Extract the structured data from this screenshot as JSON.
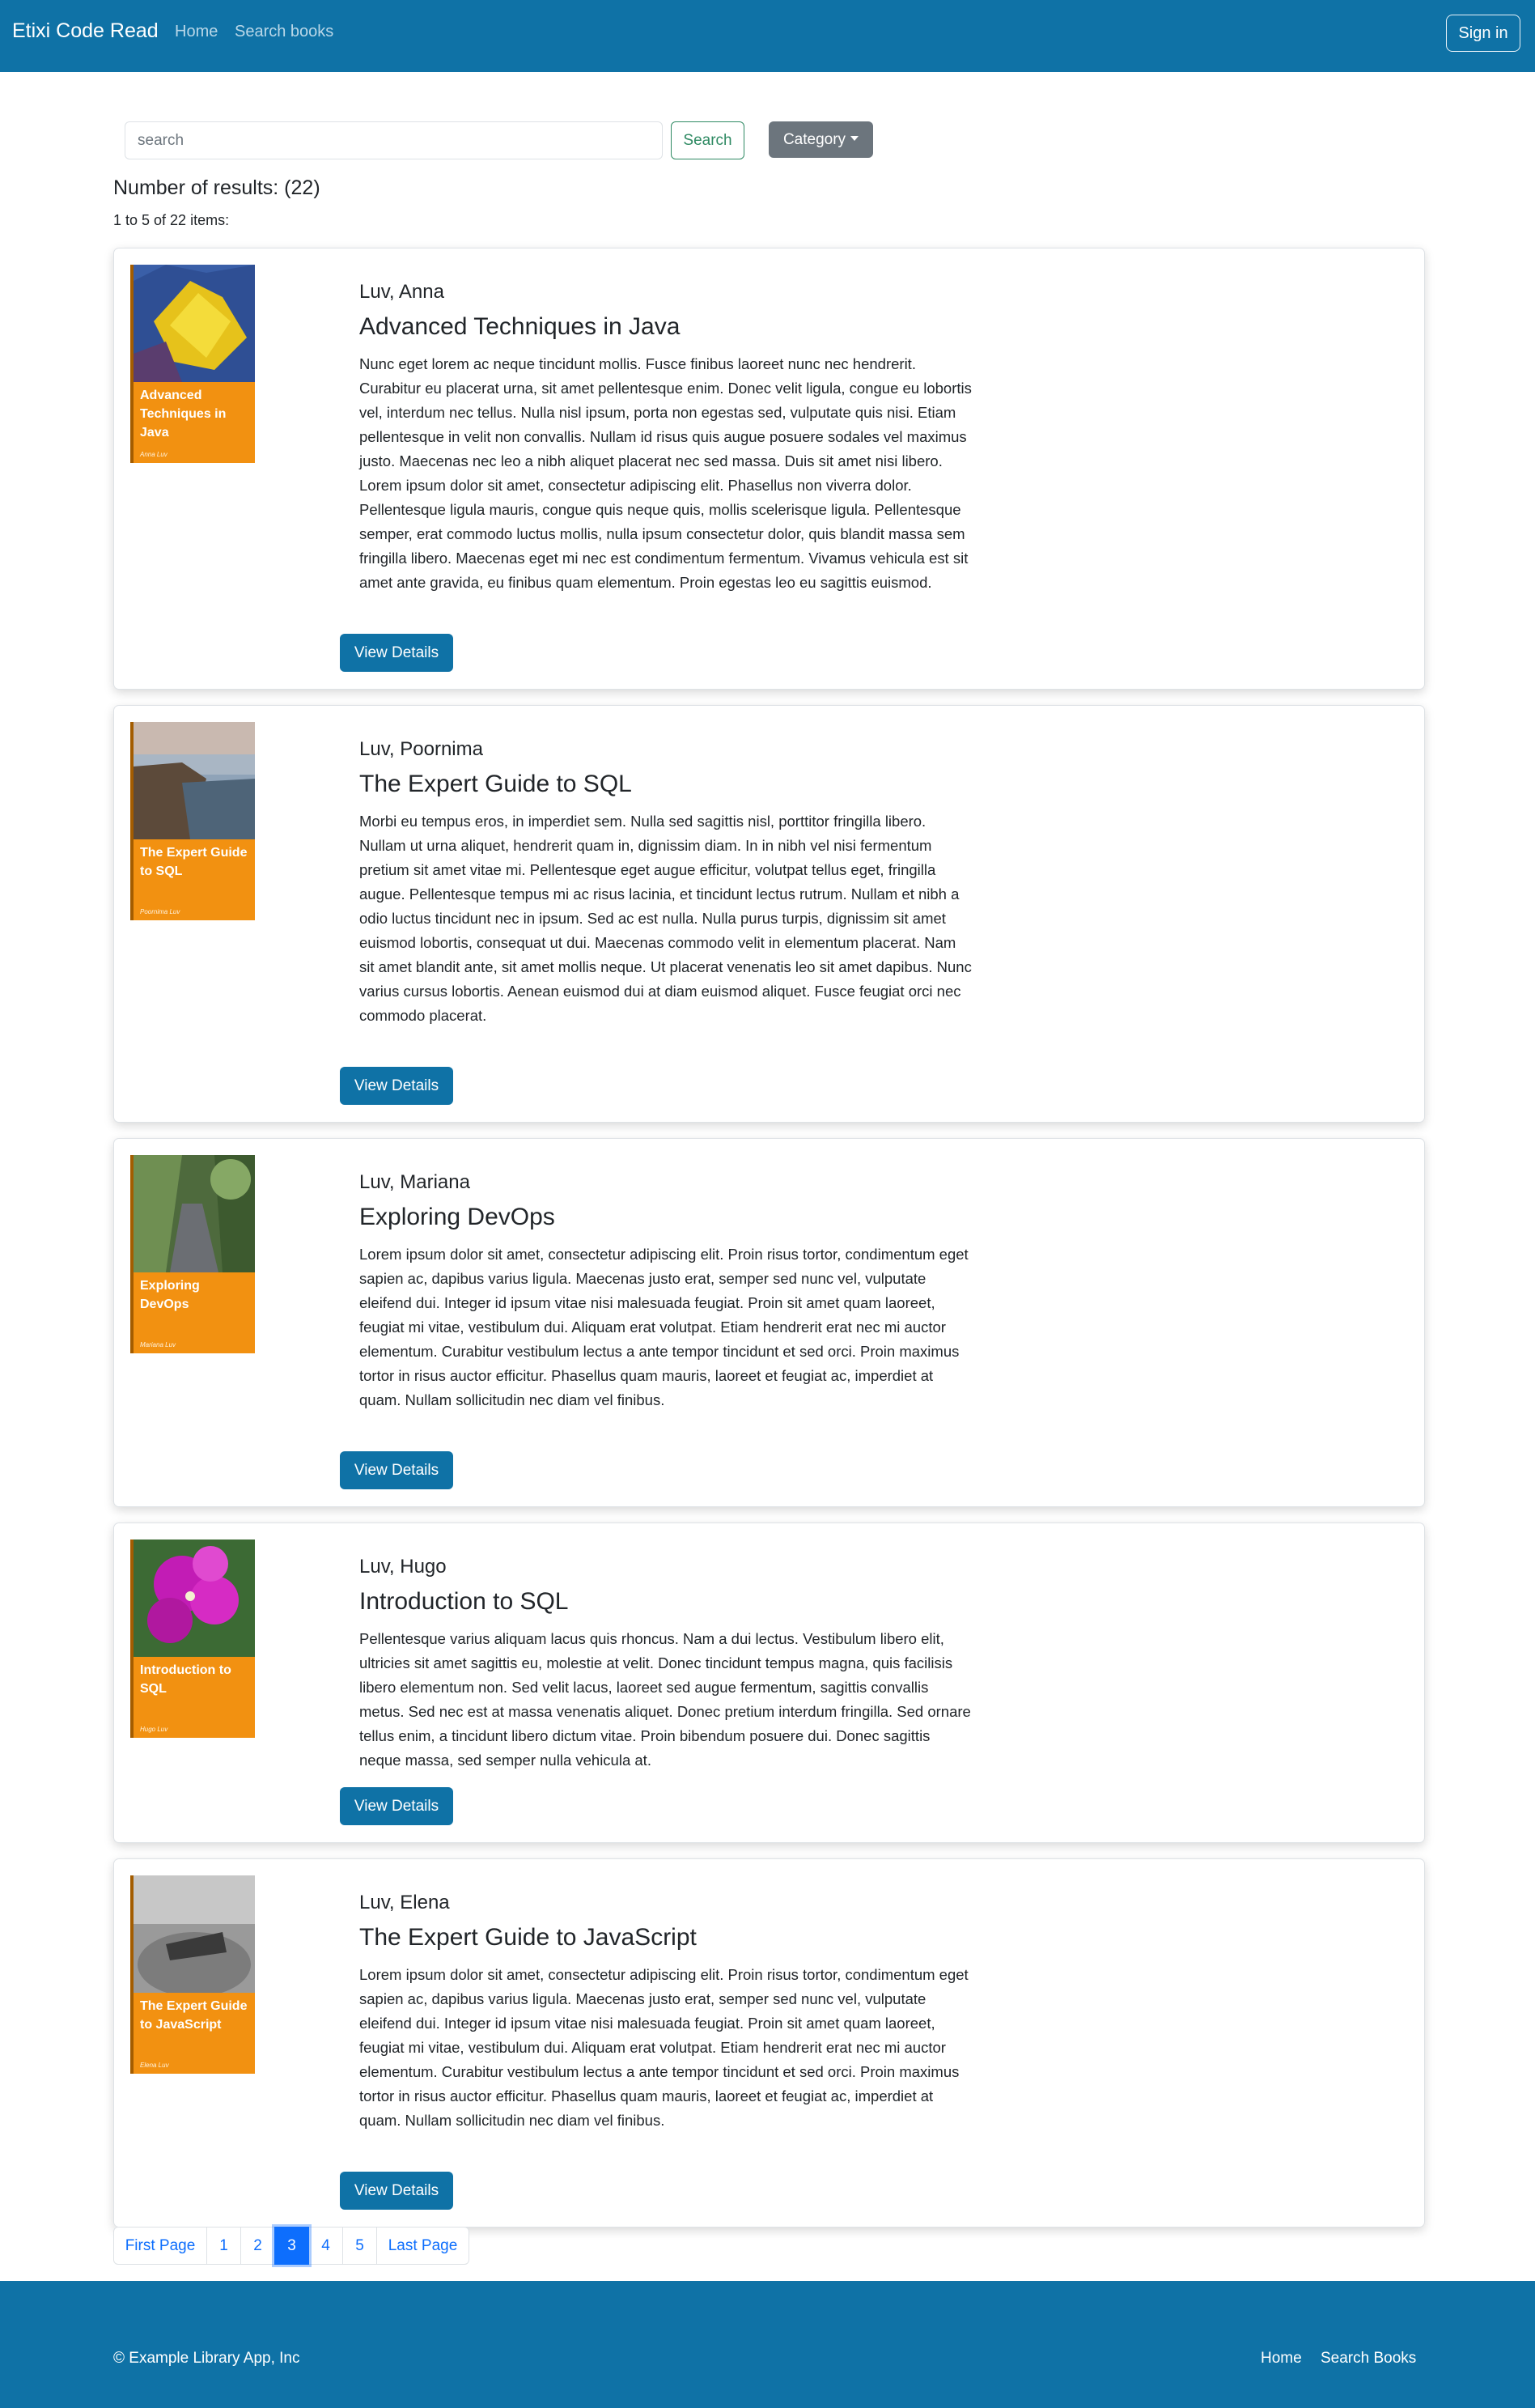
{
  "navbar": {
    "brand": "Etixi Code Read",
    "links": [
      "Home",
      "Search books"
    ],
    "signin_label": "Sign in",
    "color": "#0f72a6"
  },
  "search": {
    "placeholder": "search",
    "button_label": "Search",
    "category_label": "Category"
  },
  "results": {
    "count_text": "Number of results: (22)",
    "range_text": "1 to 5 of 22 items:"
  },
  "books": [
    {
      "author": "Luv, Anna",
      "title": "Advanced Techniques in Java",
      "description": "Nunc eget lorem ac neque tincidunt mollis. Fusce finibus laoreet nunc nec hendrerit. Curabitur eu placerat urna, sit amet pellentesque enim. Donec velit ligula, congue eu lobortis vel, interdum nec tellus. Nulla nisl ipsum, porta non egestas sed, vulputate quis nisi. Etiam pellentesque in velit non convallis. Nullam id risus quis augue posuere sodales vel maximus justo. Maecenas nec leo a nibh aliquet placerat nec sed massa. Duis sit amet nisi libero. Lorem ipsum dolor sit amet, consectetur adipiscing elit. Phasellus non viverra dolor. Pellentesque ligula mauris, congue quis neque quis, mollis scelerisque ligula. Pellentesque semper, erat commodo luctus mollis, nulla ipsum consectetur dolor, quis blandit massa sem fringilla libero. Maecenas eget mi nec est condimentum fermentum. Vivamus vehicula est sit amet ante gravida, eu finibus quam elementum. Proin egestas leo eu sagittis euismod.",
      "cover_title": "Advanced Techniques in Java",
      "cover_author": "Anna Luv",
      "button_label": "View Details"
    },
    {
      "author": "Luv, Poornima",
      "title": "The Expert Guide to SQL",
      "description": "Morbi eu tempus eros, in imperdiet sem. Nulla sed sagittis nisl, porttitor fringilla libero. Nullam ut urna aliquet, hendrerit quam in, dignissim diam. In in nibh vel nisi fermentum pretium sit amet vitae mi. Pellentesque eget augue efficitur, volutpat tellus eget, fringilla augue. Pellentesque tempus mi ac risus lacinia, et tincidunt lectus rutrum. Nullam et nibh a odio luctus tincidunt nec in ipsum. Sed ac est nulla. Nulla purus turpis, dignissim sit amet euismod lobortis, consequat ut dui. Maecenas commodo velit in elementum placerat. Nam sit amet blandit ante, sit amet mollis neque. Ut placerat venenatis leo sit amet dapibus. Nunc varius cursus lobortis. Aenean euismod dui at diam euismod aliquet. Fusce feugiat orci nec commodo placerat.",
      "cover_title": "The Expert Guide to SQL",
      "cover_author": "Poornima Luv",
      "button_label": "View Details"
    },
    {
      "author": "Luv, Mariana",
      "title": "Exploring DevOps",
      "description": "Lorem ipsum dolor sit amet, consectetur adipiscing elit. Proin risus tortor, condimentum eget sapien ac, dapibus varius ligula. Maecenas justo erat, semper sed nunc vel, vulputate eleifend dui. Integer id ipsum vitae nisi malesuada feugiat. Proin sit amet quam laoreet, feugiat mi vitae, vestibulum dui. Aliquam erat volutpat. Etiam hendrerit erat nec mi auctor elementum. Curabitur vestibulum lectus a ante tempor tincidunt et sed orci. Proin maximus tortor in risus auctor efficitur. Phasellus quam mauris, laoreet et feugiat ac, imperdiet at quam. Nullam sollicitudin nec diam vel finibus.",
      "cover_title": "Exploring DevOps",
      "cover_author": "Mariana Luv",
      "button_label": "View Details"
    },
    {
      "author": "Luv, Hugo",
      "title": "Introduction to SQL",
      "description": "Pellentesque varius aliquam lacus quis rhoncus. Nam a dui lectus. Vestibulum libero elit, ultricies sit amet sagittis eu, molestie at velit. Donec tincidunt tempus magna, quis facilisis libero elementum non. Sed velit lacus, laoreet sed augue fermentum, sagittis convallis metus. Sed nec est at massa venenatis aliquet. Donec pretium interdum fringilla. Sed ornare tellus enim, a tincidunt libero dictum vitae. Proin bibendum posuere dui. Donec sagittis neque massa, sed semper nulla vehicula at.",
      "cover_title": "Introduction to SQL",
      "cover_author": "Hugo Luv",
      "button_label": "View Details"
    },
    {
      "author": "Luv, Elena",
      "title": "The Expert Guide to JavaScript",
      "description": "Lorem ipsum dolor sit amet, consectetur adipiscing elit. Proin risus tortor, condimentum eget sapien ac, dapibus varius ligula. Maecenas justo erat, semper sed nunc vel, vulputate eleifend dui. Integer id ipsum vitae nisi malesuada feugiat. Proin sit amet quam laoreet, feugiat mi vitae, vestibulum dui. Aliquam erat volutpat. Etiam hendrerit erat nec mi auctor elementum. Curabitur vestibulum lectus a ante tempor tincidunt et sed orci. Proin maximus tortor in risus auctor efficitur. Phasellus quam mauris, laoreet et feugiat ac, imperdiet at quam. Nullam sollicitudin nec diam vel finibus.",
      "cover_title": "The Expert Guide to JavaScript",
      "cover_author": "Elena Luv",
      "button_label": "View Details"
    }
  ],
  "pagination": {
    "items": [
      "First Page",
      "1",
      "2",
      "3",
      "4",
      "5",
      "Last Page"
    ],
    "active": "3"
  },
  "footer": {
    "copyright": "© Example Library App, Inc",
    "links": [
      "Home",
      "Search Books"
    ]
  }
}
